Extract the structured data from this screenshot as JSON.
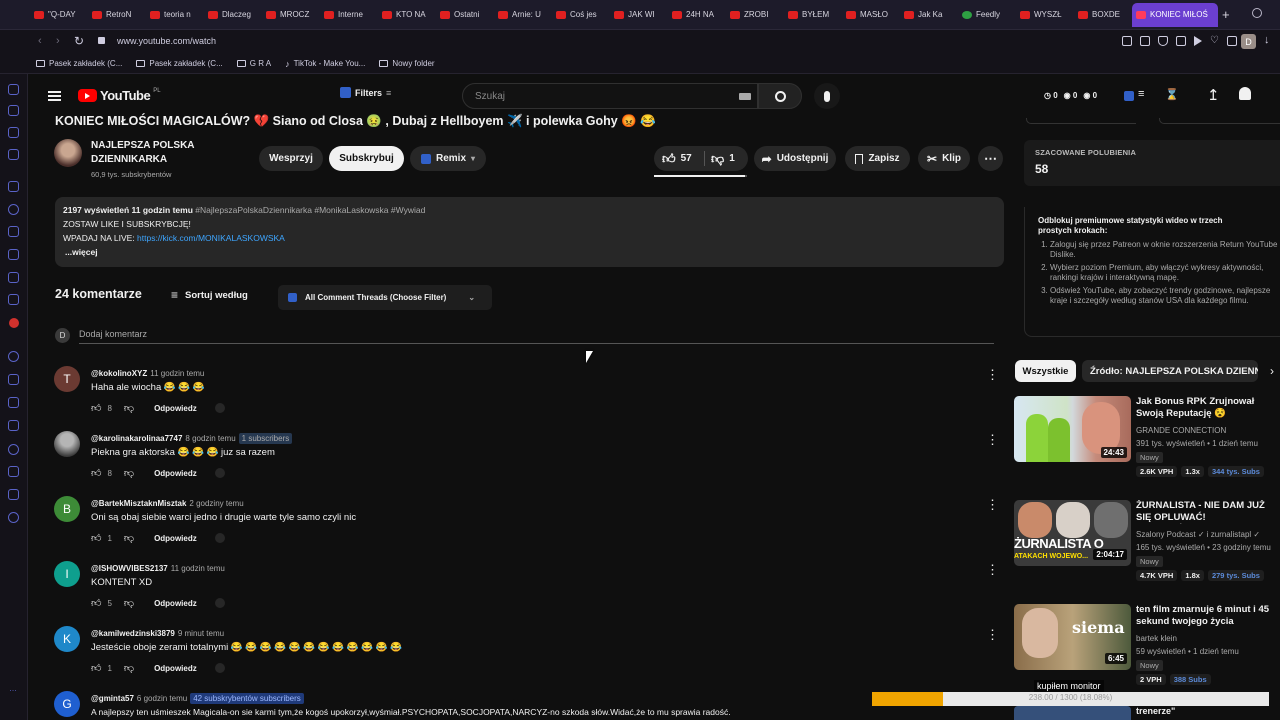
{
  "tabs": [
    {
      "label": "\"Q-DAY"
    },
    {
      "label": "RetroN"
    },
    {
      "label": "teoria n"
    },
    {
      "label": "Dlaczeg"
    },
    {
      "label": "MROCZ"
    },
    {
      "label": "Interne"
    },
    {
      "label": "KTO NA"
    },
    {
      "label": "Ostatni"
    },
    {
      "label": "Arnie: U"
    },
    {
      "label": "Coś jes"
    },
    {
      "label": "JAK WI"
    },
    {
      "label": "24H NA"
    },
    {
      "label": "ZROBI"
    },
    {
      "label": "BYŁEM"
    },
    {
      "label": "MASŁO"
    },
    {
      "label": "Jak Ka"
    },
    {
      "label": "Feedly"
    },
    {
      "label": "WYSZŁ"
    },
    {
      "label": "BOXDE"
    },
    {
      "label": "KONIEC MIŁOŚ"
    }
  ],
  "address": {
    "url": "www.youtube.com/watch"
  },
  "bookmarks": [
    {
      "label": "Pasek zakładek (C..."
    },
    {
      "label": "Pasek zakładek (C..."
    },
    {
      "label": "G R A"
    },
    {
      "label": "TikTok - Make You..."
    },
    {
      "label": "Nowy folder"
    }
  ],
  "yt_header": {
    "logo": "YouTube",
    "country": "PL",
    "filters": "Filters",
    "search_placeholder": "Szukaj",
    "counters": [
      "0",
      "0",
      "0"
    ]
  },
  "video": {
    "title": "KONIEC MIŁOŚCI MAGICALÓW? 💔 Siano od Closa 🤢 , Dubaj z Hellboyem ✈️ i polewka Gohy 😡 😂",
    "channel_line1": "NAJLEPSZA POLSKA",
    "channel_line2": "DZIENNIKARKA",
    "subscribers": "60,9 tys. subskrybentów",
    "support": "Wesprzyj",
    "subscribe": "Subskrybuj",
    "remix": "Remix",
    "likes": "57",
    "dislikes": "1",
    "share": "Udostępnij",
    "save": "Zapisz",
    "clip": "Klip"
  },
  "description": {
    "stats": "2197 wyświetleń  11 godzin temu",
    "tags": "#NajlepszaPolskaDziennikarka #MonikaLaskowska #Wywiad",
    "line2": "ZOSTAW LIKE I SUBSKRYBCJĘ!",
    "line3_prefix": "WPADAJ NA LIVE: ",
    "line3_link": "https://kick.com/MONIKALASKOWSKA",
    "more": "...więcej"
  },
  "comments_header": {
    "count": "24 komentarze",
    "sort": "Sortuj według",
    "filter": "All Comment Threads (Choose Filter)",
    "add_placeholder": "Dodaj komentarz",
    "my_avatar": "D"
  },
  "comments": [
    {
      "avatar": "T",
      "color": "#6b3a32",
      "author": "@kokolinoXYZ",
      "time": "11 godzin temu",
      "badge": "",
      "text": "Haha ale wiocha 😂 😂 😂",
      "likes": "8",
      "reply": "Odpowiedz"
    },
    {
      "avatar": "",
      "color": "#555555",
      "author": "@karolinakarolinaa7747",
      "time": "8 godzin temu",
      "badge": "1 subscribers",
      "text": "Piekna gra aktorska 😂 😂 😂 juz sa razem",
      "likes": "8",
      "reply": "Odpowiedz"
    },
    {
      "avatar": "B",
      "color": "#3d8b37",
      "author": "@BartekMisztaknMisztak",
      "time": "2 godziny temu",
      "badge": "",
      "text": "Oni są obaj siebie warci jedno i drugie warte tyle samo czyli nic",
      "likes": "1",
      "reply": "Odpowiedz"
    },
    {
      "avatar": "I",
      "color": "#0e9f8e",
      "author": "@ISHOWVIBES2137",
      "time": "11 godzin temu",
      "badge": "",
      "text": "KONTENT XD",
      "likes": "5",
      "reply": "Odpowiedz"
    },
    {
      "avatar": "K",
      "color": "#1f88c9",
      "author": "@kamilwedzinski3879",
      "time": "9 minut temu",
      "badge": "",
      "text": "Jesteście oboje zerami totalnymi 😂 😂 😂 😂 😂 😂 😂 😂 😂 😂 😂 😂",
      "likes": "1",
      "reply": "Odpowiedz"
    },
    {
      "avatar": "G",
      "color": "#1f5fd0",
      "author": "@gminta57",
      "time": "6 godzin temu",
      "badge": "42 subskrybentów subscribers",
      "text": "A najlepszy ten uśmieszek Magicala-on sie karmi tym,że kogoś upokorzył,wyśmiał.PSYCHOPATA,SOCJOPATA,NARCYZ-no szkoda słów.Widać,że to mu sprawia radość.",
      "likes": "",
      "reply": ""
    }
  ],
  "estimated_likes": {
    "label": "SZACOWANE POLUBIENIA",
    "value": "58"
  },
  "premium": {
    "title": "Odblokuj premiumowe statystyki wideo w trzech prostych krokach:",
    "steps": [
      "Zaloguj się przez Patreon w oknie rozszerzenia Return YouTube Dislike.",
      "Wybierz poziom Premium, aby włączyć wykresy aktywności, rankingi krajów i interaktywną mapę.",
      "Odśwież YouTube, aby zobaczyć trendy godzinowe, najlepsze kraje i szczegóły według stanów USA dla każdego filmu."
    ]
  },
  "chips": [
    "Wszystkie",
    "Źródło: NAJLEPSZA POLSKA DZIENNIKARKA"
  ],
  "recs": [
    {
      "title": "Jak Bonus RPK Zrujnował Swoją Reputację 😵",
      "channel": "GRANDE CONNECTION",
      "views": "391 tys. wyświetleń • 1 dzień temu",
      "duration": "24:43",
      "new": "Nowy",
      "vph": "2.6K VPH",
      "mult": "1.3x",
      "subs": "344 tys. Subs"
    },
    {
      "title": "ŻURNALISTA - NIE DAM JUŻ SIĘ OPLUWAĆ! (WOJEWÓDZKI...",
      "channel": "Szalony Podcast ✓ i zurnalistapl ✓",
      "views": "165 tys. wyświetleń • 23 godziny temu",
      "duration": "2:04:17",
      "new": "Nowy",
      "vph": "4.7K VPH",
      "mult": "1.8x",
      "subs": "279 tys. Subs",
      "thumb_text": "ŻURNALISTA O",
      "thumb_sub": "ATAKACH WOJEWO..."
    },
    {
      "title": "ten film zmarnuje 6 minut i 45 sekund twojego życia",
      "channel": "bartek klein",
      "views": "59 wyświetleń • 1 dzień temu",
      "duration": "6:45",
      "new": "Nowy",
      "vph": "2 VPH",
      "mult": "",
      "subs": "388 Subs",
      "thumb_text": "siema"
    }
  ],
  "overlay": {
    "label": "kupiłem monitor",
    "progress_text": "238.00 / 1300 (18.08%)",
    "progress": 0.18,
    "next_title": "trenerze\""
  }
}
